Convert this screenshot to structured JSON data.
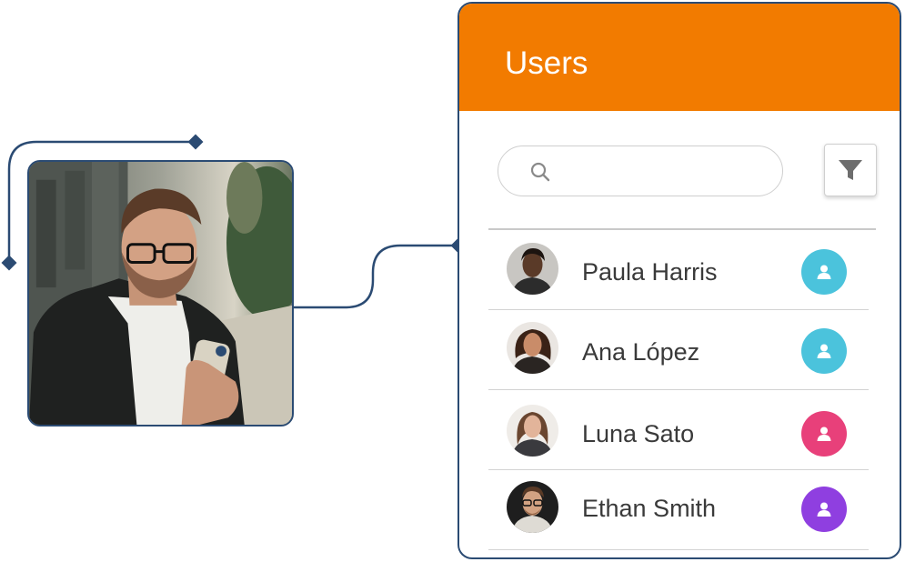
{
  "panel": {
    "title": "Users",
    "header_color": "#f27b00",
    "border_color": "#2b4b73"
  },
  "search": {
    "placeholder": "",
    "value": "",
    "icon": "search-icon"
  },
  "filter": {
    "icon": "filter-icon"
  },
  "users": [
    {
      "name": "Paula Harris",
      "badge_color": "#4bc3dc",
      "badge_icon": "person-icon"
    },
    {
      "name": "Ana López",
      "badge_color": "#4bc3dc",
      "badge_icon": "person-icon"
    },
    {
      "name": "Luna Sato",
      "badge_color": "#e8407a",
      "badge_icon": "person-icon"
    },
    {
      "name": "Ethan Smith",
      "badge_color": "#8f3fe0",
      "badge_icon": "person-icon"
    }
  ],
  "photo": {
    "subject": "man-using-phone-photo"
  },
  "connector_color": "#2b4b73"
}
